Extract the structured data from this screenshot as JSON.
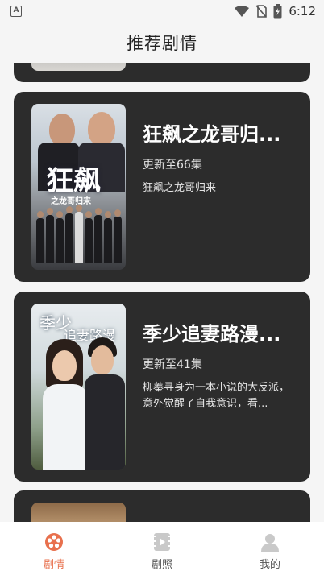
{
  "status_bar": {
    "time": "6:12",
    "left_icon": "A"
  },
  "header": {
    "title": "推荐剧情"
  },
  "dramas": [
    {
      "title": "狂飙之龙哥归来",
      "title_display": "狂飙之龙哥归...",
      "update": "更新至66集",
      "description": "狂飙之龙哥归来",
      "poster_title": "狂飙",
      "poster_subtitle": "之龙哥归来"
    },
    {
      "title": "季少追妻路漫漫",
      "title_display": "季少追妻路漫...",
      "update": "更新至41集",
      "description": "柳蓁寻身为一本小说的大反派，意外觉醒了自我意识，看...",
      "poster_calligraphy_1": "季少",
      "poster_calligraphy_2": "追妻路漫漫"
    }
  ],
  "tabbar": {
    "items": [
      {
        "label": "剧情",
        "icon": "film-reel-icon",
        "active": true
      },
      {
        "label": "剧照",
        "icon": "photo-film-icon",
        "active": false
      },
      {
        "label": "我的",
        "icon": "user-icon",
        "active": false
      }
    ]
  },
  "colors": {
    "accent": "#e8704d",
    "card_bg": "#2c2c2c",
    "page_bg": "#f5f5f5"
  }
}
